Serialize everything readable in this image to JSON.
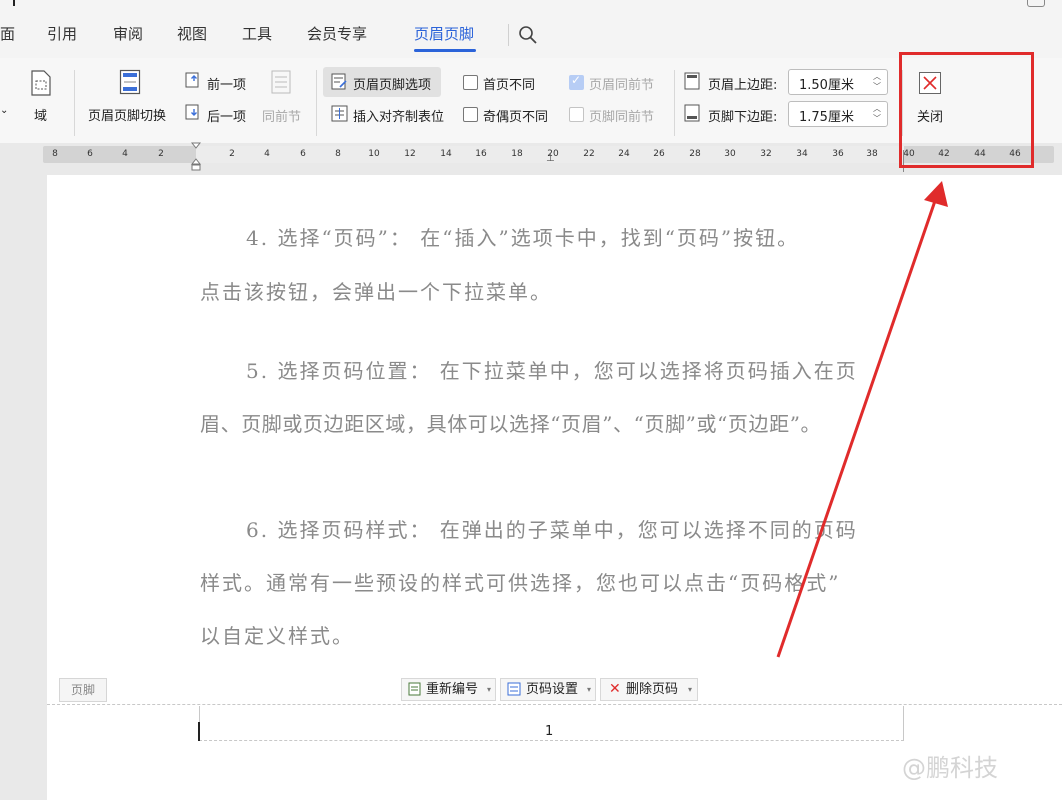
{
  "tabs": [
    {
      "label": "面",
      "active": false
    },
    {
      "label": "引用",
      "active": false
    },
    {
      "label": "审阅",
      "active": false
    },
    {
      "label": "视图",
      "active": false
    },
    {
      "label": "工具",
      "active": false
    },
    {
      "label": "会员专享",
      "active": false
    },
    {
      "label": "页眉页脚",
      "active": true
    }
  ],
  "ribbon": {
    "field_label": "域",
    "switch_label": "页眉页脚切换",
    "prev_label": "前一项",
    "next_label": "后一项",
    "same_as_prev_label": "同前节",
    "options_label": "页眉页脚选项",
    "insert_tab_label": "插入对齐制表位",
    "first_page_diff_label": "首页不同",
    "odd_even_diff_label": "奇偶页不同",
    "header_same_prev_label": "页眉同前节",
    "footer_same_prev_label": "页脚同前节",
    "header_top_label": "页眉上边距:",
    "header_top_value": "1.50厘米",
    "footer_bottom_label": "页脚下边距:",
    "footer_bottom_value": "1.75厘米",
    "close_label": "关闭"
  },
  "ruler": {
    "ticks": [
      "8",
      "6",
      "4",
      "2",
      "2",
      "4",
      "6",
      "8",
      "10",
      "12",
      "14",
      "16",
      "18",
      "20",
      "22",
      "24",
      "26",
      "28",
      "30",
      "32",
      "34",
      "36",
      "38",
      "40",
      "42",
      "44",
      "46"
    ]
  },
  "document": {
    "paragraphs": [
      "4. 选择“页码”： 在“插入”选项卡中，找到“页码”按钮。",
      "点击该按钮，会弹出一个下拉菜单。",
      "5. 选择页码位置： 在下拉菜单中，您可以选择将页码插入在页",
      "眉、页脚或页边距区域，具体可以选择“页眉”、“页脚”或“页边距”。",
      "6. 选择页码样式： 在弹出的子菜单中，您可以选择不同的页码",
      "样式。通常有一些预设的样式可供选择，您也可以点击“页码格式”",
      "以自定义样式。"
    ]
  },
  "footer": {
    "tag": "页脚",
    "renumber_label": "重新编号",
    "page_setup_label": "页码设置",
    "delete_label": "删除页码",
    "page_number": "1"
  },
  "watermark": "@鹏科技",
  "colors": {
    "accent": "#2b63d9",
    "annotation": "#e02b2b"
  }
}
